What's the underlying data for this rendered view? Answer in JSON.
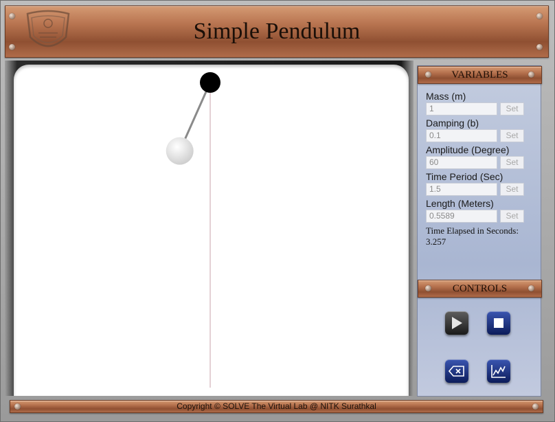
{
  "app": {
    "title": "Simple Pendulum",
    "footer": "Copyright © SOLVE The Virtual Lab @ NITK Surathkal"
  },
  "variables_panel": {
    "header": "VARIABLES",
    "fields": [
      {
        "label": "Mass (m)",
        "value": "1",
        "button": "Set"
      },
      {
        "label": "Damping (b)",
        "value": "0.1",
        "button": "Set"
      },
      {
        "label": "Amplitude (Degree)",
        "value": "60",
        "button": "Set"
      },
      {
        "label": "Time Period (Sec)",
        "value": "1.5",
        "button": "Set"
      },
      {
        "label": "Length (Meters)",
        "value": "0.5589",
        "button": "Set"
      }
    ],
    "elapsed_label": "Time Elapsed in Seconds:",
    "elapsed_value": "3.257"
  },
  "controls_panel": {
    "header": "CONTROLS",
    "buttons": [
      {
        "icon": "play-icon"
      },
      {
        "icon": "stop-icon"
      },
      {
        "icon": "clear-icon"
      },
      {
        "icon": "graph-icon"
      }
    ]
  },
  "simulation": {
    "pivot_color": "#000000",
    "string_color": "#8a8a8a",
    "bob_color": "#dcdcdc",
    "rest_line_color": "#c8a0aa",
    "swing_angle_degrees": -24
  }
}
